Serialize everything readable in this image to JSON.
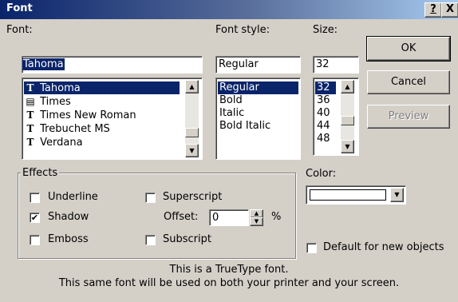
{
  "titlebar": {
    "title": "Font",
    "help_label": "?",
    "close_label": "X"
  },
  "font": {
    "label": "Font:",
    "value": "Tahoma",
    "items": [
      {
        "label": "Tahoma",
        "icon": "truetype-icon",
        "selected": true
      },
      {
        "label": "Times",
        "icon": "printer-font-icon",
        "selected": false
      },
      {
        "label": "Times New Roman",
        "icon": "truetype-icon",
        "selected": false
      },
      {
        "label": "Trebuchet MS",
        "icon": "truetype-icon",
        "selected": false
      },
      {
        "label": "Verdana",
        "icon": "truetype-icon",
        "selected": false
      }
    ]
  },
  "style": {
    "label": "Font style:",
    "value": "Regular",
    "items": [
      {
        "label": "Regular",
        "selected": true
      },
      {
        "label": "Bold",
        "selected": false
      },
      {
        "label": "Italic",
        "selected": false
      },
      {
        "label": "Bold Italic",
        "selected": false
      }
    ]
  },
  "size": {
    "label": "Size:",
    "value": "32",
    "items": [
      {
        "label": "32",
        "selected": true
      },
      {
        "label": "36",
        "selected": false
      },
      {
        "label": "40",
        "selected": false
      },
      {
        "label": "44",
        "selected": false
      },
      {
        "label": "48",
        "selected": false
      }
    ]
  },
  "buttons": {
    "ok": "OK",
    "cancel": "Cancel",
    "preview": "Preview"
  },
  "effects": {
    "label": "Effects",
    "underline": {
      "label": "Underline",
      "checked": false
    },
    "superscript": {
      "label": "Superscript",
      "checked": false
    },
    "shadow": {
      "label": "Shadow",
      "checked": true
    },
    "offset": {
      "label": "Offset:",
      "value": "0",
      "unit": "%"
    },
    "emboss": {
      "label": "Emboss",
      "checked": false
    },
    "subscript": {
      "label": "Subscript",
      "checked": false
    }
  },
  "color": {
    "label": "Color:",
    "value_color": "#ffffff"
  },
  "default_for_new": {
    "label": "Default for new objects",
    "checked": false
  },
  "info": {
    "line1": "This is a TrueType font.",
    "line2": "This same font will be used on both your printer and your screen."
  }
}
